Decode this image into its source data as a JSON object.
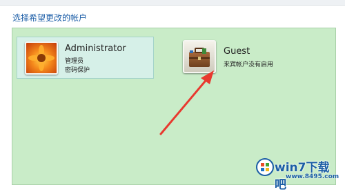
{
  "page": {
    "title": "选择希望更改的帐户"
  },
  "accounts": [
    {
      "name": "Administrator",
      "lines": [
        "管理员",
        "密码保护"
      ],
      "icon": "flower-avatar-icon",
      "selected": true
    },
    {
      "name": "Guest",
      "lines": [
        "来宾帐户没有启用"
      ],
      "icon": "briefcase-avatar-icon",
      "selected": false
    }
  ],
  "annotation": {
    "color": "#e8392f"
  },
  "watermark": {
    "brand": "win7下载吧",
    "site": "www.8495.com"
  }
}
